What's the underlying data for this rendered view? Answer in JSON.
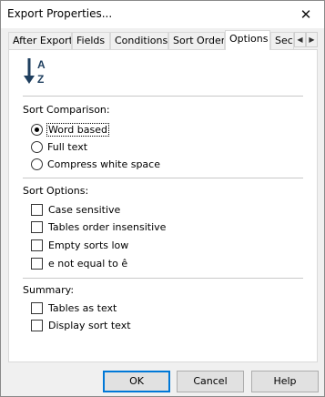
{
  "window": {
    "title": "Export Properties...",
    "close_glyph": "✕"
  },
  "tabs": [
    {
      "label": "After Export"
    },
    {
      "label": "Fields"
    },
    {
      "label": "Conditions"
    },
    {
      "label": "Sort Order"
    },
    {
      "label": "Options",
      "active": true
    },
    {
      "label": "Sec"
    }
  ],
  "tab_scroll": {
    "left_glyph": "◀",
    "right_glyph": "▶"
  },
  "icon": {
    "name": "sort-ascending-icon",
    "letters": [
      "A",
      "Z"
    ]
  },
  "sort_comparison": {
    "label": "Sort Comparison:",
    "options": [
      {
        "label": "Word based",
        "checked": true
      },
      {
        "label": "Full text",
        "checked": false
      },
      {
        "label": "Compress white space",
        "checked": false
      }
    ]
  },
  "sort_options": {
    "label": "Sort Options:",
    "options": [
      {
        "label": "Case sensitive",
        "checked": false
      },
      {
        "label": "Tables order insensitive",
        "checked": false
      },
      {
        "label": "Empty sorts low",
        "checked": false
      },
      {
        "label": "e not equal to ê",
        "checked": false
      }
    ]
  },
  "summary": {
    "label": "Summary:",
    "options": [
      {
        "label": "Tables as text",
        "checked": false
      },
      {
        "label": "Display sort text",
        "checked": false
      }
    ]
  },
  "buttons": {
    "ok": "OK",
    "cancel": "Cancel",
    "help": "Help"
  },
  "colors": {
    "accent": "#0078d7",
    "icon": "#1f3f5f"
  }
}
